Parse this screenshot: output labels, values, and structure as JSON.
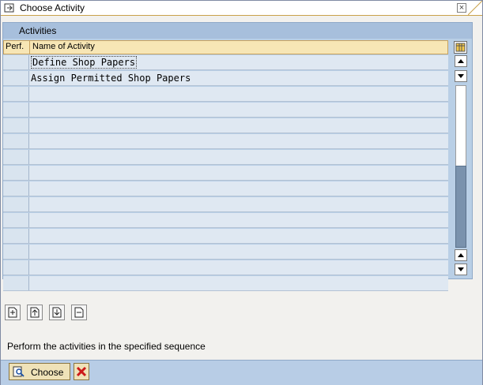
{
  "window": {
    "title": "Choose Activity",
    "close_label": "×"
  },
  "panel": {
    "title": "Activities"
  },
  "table": {
    "columns": [
      "Perf.",
      "Name of Activity"
    ],
    "rows": [
      {
        "perf": "",
        "name": "Define Shop Papers",
        "focused": true
      },
      {
        "perf": "",
        "name": "Assign Permitted Shop Papers",
        "focused": false
      },
      {
        "perf": "",
        "name": ""
      },
      {
        "perf": "",
        "name": ""
      },
      {
        "perf": "",
        "name": ""
      },
      {
        "perf": "",
        "name": ""
      },
      {
        "perf": "",
        "name": ""
      },
      {
        "perf": "",
        "name": ""
      },
      {
        "perf": "",
        "name": ""
      },
      {
        "perf": "",
        "name": ""
      },
      {
        "perf": "",
        "name": ""
      },
      {
        "perf": "",
        "name": ""
      },
      {
        "perf": "",
        "name": ""
      },
      {
        "perf": "",
        "name": ""
      },
      {
        "perf": "",
        "name": ""
      }
    ]
  },
  "toolbar_icons": [
    "expand-icon",
    "move-up-icon",
    "move-down-icon",
    "collapse-icon"
  ],
  "hint_text": "Perform the activities in the specified sequence",
  "footer": {
    "choose_label": "Choose"
  },
  "colors": {
    "panel_blue": "#b9cfe6",
    "header_gold": "#f7e6b5",
    "scroll_thumb": "#7a92ad",
    "cancel_red": "#cc1a1a"
  }
}
